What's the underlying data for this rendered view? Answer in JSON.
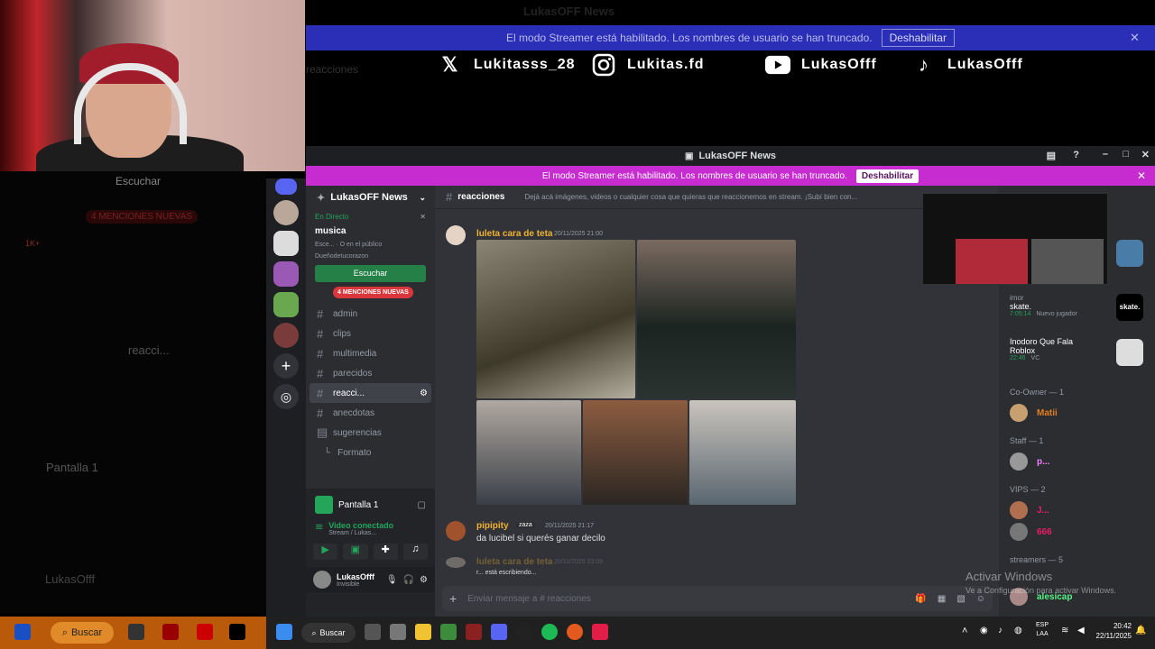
{
  "overlay": {
    "faint_title": "LukasOFF News",
    "banner_text": "El modo Streamer está habilitado. Los nombres de usuario se han truncado.",
    "banner_button": "Deshabilitar",
    "faint_channel": "reacciones",
    "socials": [
      {
        "icon": "x-icon",
        "handle": "Lukitasss_28"
      },
      {
        "icon": "instagram-icon",
        "handle": "Lukitas.fd"
      },
      {
        "icon": "youtube-icon",
        "handle": "LukasOfff"
      },
      {
        "icon": "tiktok-icon",
        "handle": "LukasOfff"
      }
    ]
  },
  "left_bg": {
    "listen": "Escuchar",
    "mentions": "4 MENCIONES NUEVAS",
    "badge": "1K+",
    "channel": "reacci...",
    "screen": "Pantalla 1",
    "user": "LukasOfff"
  },
  "window": {
    "title": "LukasOFF News",
    "streamer_banner": "El modo Streamer está habilitado. Los nombres de usuario se han truncado.",
    "streamer_button": "Deshabilitar"
  },
  "sidebar": {
    "server_name": "LukasOFF News",
    "live_label": "En Directo",
    "stage_name": "musica",
    "stage_sub": "Esce... · O en el público",
    "stage_owner": "Dueñodetucorazon",
    "listen_button": "Escuchar",
    "mentions_pill": "4 MENCIONES NUEVAS",
    "channels": [
      {
        "name": "admin",
        "active": false
      },
      {
        "name": "clips",
        "active": false
      },
      {
        "name": "multimedia",
        "active": false
      },
      {
        "name": "parecidos",
        "active": false
      },
      {
        "name": "reacci...",
        "active": true
      },
      {
        "name": "anecdotas",
        "active": false
      }
    ],
    "forum": "sugerencias",
    "thread": "Formato",
    "screen_share": "Pantalla 1",
    "video_connected": "Video conectado",
    "video_sub": "Stream / Lukas...",
    "user_name": "LukasOfff",
    "user_status": "Invisible"
  },
  "chat": {
    "channel_name": "reacciones",
    "topic": "Dejá acá imágenes, videos o cualquier cosa que quieras que reaccionemos en stream. ¡Subí bien con...",
    "messages": [
      {
        "author": "luleta cara de teta",
        "time": "20/11/2025 21:00"
      },
      {
        "author": "pipipity",
        "tag": "zaza",
        "time": "20/11/2025 21:17",
        "text": "da lucibel si querés ganar decilo"
      },
      {
        "author": "luleta cara de teta",
        "time": "20/11/2025 23:09"
      }
    ],
    "typing": "r... está escribiendo...",
    "input_placeholder": "Enviar mensaje a #  reacciones"
  },
  "members": {
    "activities": [
      {
        "name": "imor",
        "game": "skate.",
        "time": "7:05:14",
        "extra": "Nuevo jugador"
      },
      {
        "name": "Inodoro Que Fala",
        "game": "Roblox",
        "time": "22:46",
        "extra": "VC"
      }
    ],
    "groups": [
      {
        "title": "Co-Owner — 1",
        "members": [
          {
            "name": "Matii",
            "color": "#e67e22"
          }
        ]
      },
      {
        "title": "Staff — 1",
        "members": [
          {
            "name": "p...",
            "color": "#f47fff"
          }
        ]
      },
      {
        "title": "VIPS — 2",
        "members": [
          {
            "name": "J...",
            "color": "#e91e63"
          },
          {
            "name": "666",
            "color": "#e91e63"
          }
        ]
      },
      {
        "title": "streamers — 5",
        "members": [
          {
            "name": "alesicap",
            "color": "#57f287"
          }
        ]
      }
    ]
  },
  "watermark": {
    "title": "Activar Windows",
    "sub": "Ve a Configuración para activar Windows."
  },
  "taskbar": {
    "search_left": "Buscar",
    "search": "Buscar",
    "lang1": "ESP",
    "lang2": "LAA",
    "time": "20:42",
    "date": "22/11/2025"
  }
}
